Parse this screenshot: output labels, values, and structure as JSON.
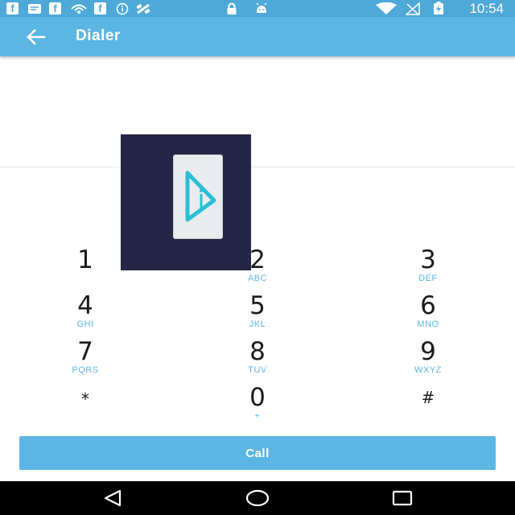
{
  "status_bar": {
    "time": "10:54",
    "left_icons": [
      "facebook-icon",
      "message-icon",
      "facebook-icon",
      "wifi-alt-icon",
      "facebook-icon",
      "info-icon",
      "satellite-icon",
      "lock-icon",
      "android-icon"
    ],
    "right_icons": [
      "wifi-icon",
      "no-signal-icon",
      "battery-charging-icon"
    ],
    "fb_glyph": "f"
  },
  "app_bar": {
    "title": "Dialer",
    "back_icon": "arrow-left-icon"
  },
  "number_display": {
    "value": ""
  },
  "keypad": {
    "keys": [
      {
        "digit": "1",
        "letters": ""
      },
      {
        "digit": "2",
        "letters": "ABC"
      },
      {
        "digit": "3",
        "letters": "DEF"
      },
      {
        "digit": "4",
        "letters": "GHI"
      },
      {
        "digit": "5",
        "letters": "JKL"
      },
      {
        "digit": "6",
        "letters": "MNO"
      },
      {
        "digit": "7",
        "letters": "PQRS"
      },
      {
        "digit": "8",
        "letters": "TUV"
      },
      {
        "digit": "9",
        "letters": "WXYZ"
      },
      {
        "digit": "*",
        "letters": ""
      },
      {
        "digit": "0",
        "letters": "+"
      },
      {
        "digit": "#",
        "letters": ""
      }
    ]
  },
  "call_button": {
    "label": "Call"
  },
  "nav_bar": {
    "icons": [
      "back-triangle-icon",
      "home-circle-icon",
      "recents-square-icon"
    ]
  },
  "colors": {
    "accent": "#5cb6e3",
    "status_bar": "#4ea9d9",
    "overlay_bg": "#252547",
    "overlay_logo": "#2bbfd6",
    "nav_bar": "#000000"
  }
}
